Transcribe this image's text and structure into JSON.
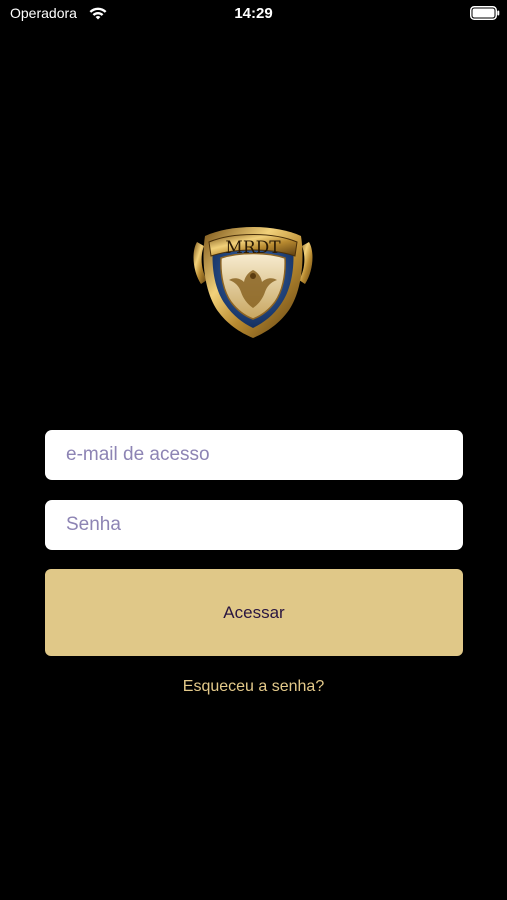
{
  "status_bar": {
    "carrier": "Operadora",
    "time": "14:29",
    "icons": [
      "wifi-icon",
      "battery-icon"
    ]
  },
  "logo": {
    "text": "MRDT",
    "colors": {
      "gold": "#c9a24a",
      "blue": "#2a4f8c"
    }
  },
  "form": {
    "email_placeholder": "e-mail de acesso",
    "password_placeholder": "Senha",
    "submit_label": "Acessar",
    "forgot_label": "Esqueceu a senha?"
  },
  "colors": {
    "background": "#000000",
    "button": "#e0c888",
    "button_text": "#2a1640",
    "link": "#e3c98a",
    "placeholder": "#8d84b4"
  }
}
